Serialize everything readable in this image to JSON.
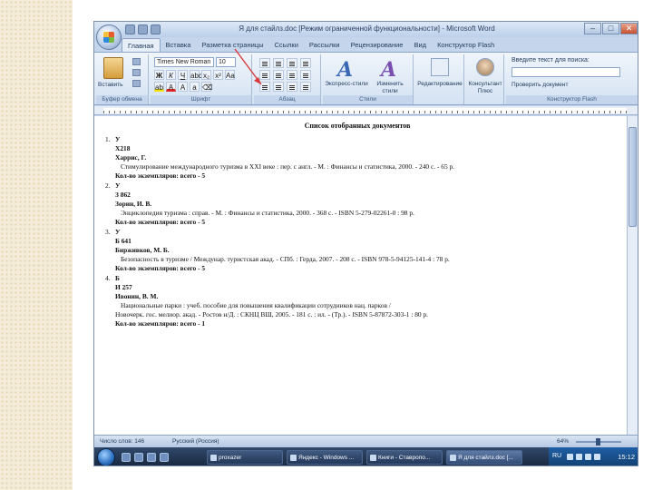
{
  "window": {
    "title": "Я для стайлз.doc [Режим ограниченной функциональности] - Microsoft Word",
    "controls": [
      "–",
      "□",
      "✕"
    ]
  },
  "ribbon": {
    "tabs": [
      "Главная",
      "Вставка",
      "Разметка страницы",
      "Ссылки",
      "Рассылки",
      "Рецензирование",
      "Вид",
      "Конструктор Flash"
    ],
    "active_tab": "Главная",
    "clipboard": {
      "paste_label": "Вставить",
      "group_label": "Буфер обмена"
    },
    "font": {
      "name": "Times New Roman",
      "size": "10",
      "group_label": "Шрифт"
    },
    "paragraph": {
      "group_label": "Абзац"
    },
    "styles": {
      "group_label": "Стили",
      "quick_styles_label": "Экспресс-стили",
      "change_styles_label": "Изменить стили"
    },
    "editing": {
      "label": "Редактирование"
    },
    "help": {
      "prompt": "Введите текст для поиска:",
      "check_label": "Проверить документ",
      "group_label": "Конструктор Flash"
    },
    "consultant_label": "Консультант Плюс"
  },
  "document": {
    "title": "Список отобранных документов",
    "entries": [
      {
        "num": "1.",
        "lines": [
          {
            "text": "У",
            "bold": true,
            "indent": false
          },
          {
            "text": "Х218",
            "bold": true,
            "indent": false
          },
          {
            "text": "Харрис, Г.",
            "bold": true,
            "indent": false
          },
          {
            "text": "Стимулирование международного туризма в XXI веке : пер. с англ. - М. : Финансы и статистика, 2000. - 240 с. - 65 р.",
            "bold": false,
            "indent": true
          },
          {
            "text": "Кол-во экземпляров: всего - 5",
            "bold": true,
            "indent": false
          }
        ]
      },
      {
        "num": "2.",
        "lines": [
          {
            "text": "У",
            "bold": true,
            "indent": false
          },
          {
            "text": "З 862",
            "bold": true,
            "indent": false
          },
          {
            "text": "Зорин, И. В.",
            "bold": true,
            "indent": false
          },
          {
            "text": "Энциклопедия туризма : справ. - М. : Финансы и статистика, 2000. - 368 с. - ISBN 5-279-02261-0 : 98 р.",
            "bold": false,
            "indent": true
          },
          {
            "text": "Кол-во экземпляров: всего - 5",
            "bold": true,
            "indent": false
          }
        ]
      },
      {
        "num": "3.",
        "lines": [
          {
            "text": "У",
            "bold": true,
            "indent": false
          },
          {
            "text": "Б 641",
            "bold": true,
            "indent": false
          },
          {
            "text": "Бирживков, М. Б.",
            "bold": true,
            "indent": false
          },
          {
            "text": "Безопасность в туризме / Междунар. туристская акад. - СПб. : Герда, 2007. - 208 с. - ISBN 978-5-94125-141-4 : 78 р.",
            "bold": false,
            "indent": true
          },
          {
            "text": "Кол-во экземпляров: всего - 5",
            "bold": true,
            "indent": false
          }
        ]
      },
      {
        "num": "4.",
        "lines": [
          {
            "text": "Б",
            "bold": true,
            "indent": false
          },
          {
            "text": "И 257",
            "bold": true,
            "indent": false
          },
          {
            "text": "Ивонин, В. М.",
            "bold": true,
            "indent": false
          },
          {
            "text": "Национальные парки : учеб. пособие для повышения квалификации сотрудников нац. парков /",
            "bold": false,
            "indent": true
          },
          {
            "text": "Новочерк. гос. мелиор. акад. - Ростов н/Д. : СКНЦ ВШ, 2005. - 181 с. : ил. - (Тр.). - ISBN 5-87872-303-1 : 80 р.",
            "bold": false,
            "indent": false
          },
          {
            "text": "Кол-во экземпляров: всего - 1",
            "bold": true,
            "indent": false
          }
        ]
      }
    ]
  },
  "statusbar": {
    "words": "Число слов: 146",
    "language": "Русский (Россия)",
    "zoom": "64%"
  },
  "taskbar": {
    "items": [
      "proxazer",
      "Яндекс - Windows ...",
      "Книги - Ставропо...",
      "Я для стайлз.doc [..."
    ],
    "active_item": 3,
    "lang": "RU",
    "time": "15:12"
  },
  "colors": {
    "ribbon": "#dbe6f4",
    "taskbar": "#1f3350",
    "annotation_arrow": "#d63a3a"
  }
}
